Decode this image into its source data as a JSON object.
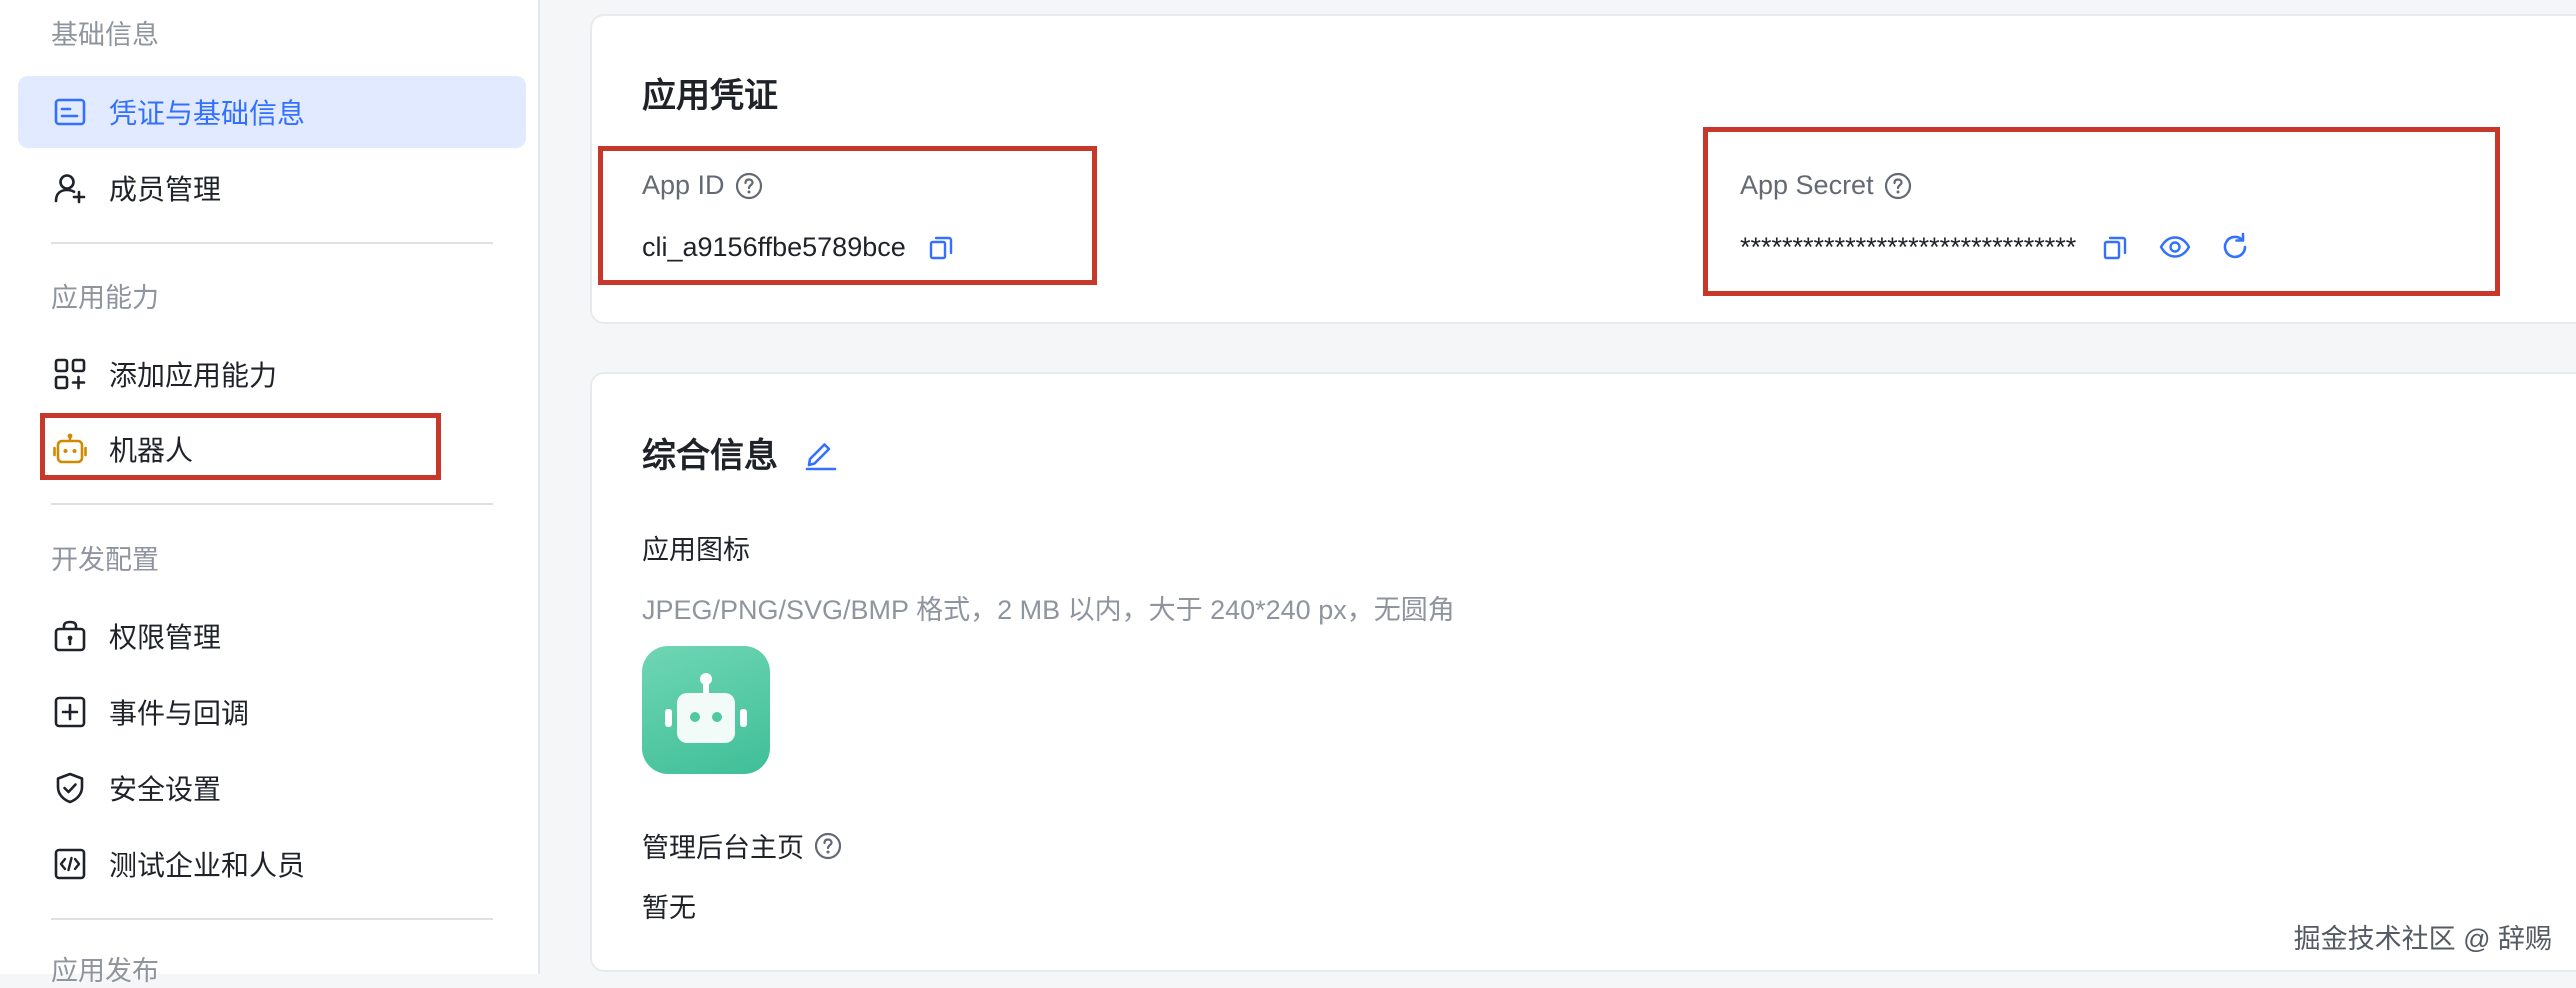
{
  "sidebar": {
    "groups": {
      "basic": "基础信息",
      "capability": "应用能力",
      "dev": "开发配置",
      "publish": "应用发布"
    },
    "items": {
      "credentials": "凭证与基础信息",
      "members": "成员管理",
      "add_capability": "添加应用能力",
      "bot": "机器人",
      "permissions": "权限管理",
      "events": "事件与回调",
      "security": "安全设置",
      "test_users": "测试企业和人员"
    }
  },
  "credentials": {
    "title": "应用凭证",
    "app_id_label": "App ID",
    "app_id_value": "cli_a9156ffbe5789bce",
    "app_secret_label": "App Secret",
    "app_secret_value": "********************************"
  },
  "info": {
    "title": "综合信息",
    "icon_label": "应用图标",
    "icon_hint": "JPEG/PNG/SVG/BMP 格式，2 MB 以内，大于 240*240 px，无圆角",
    "homepage_label": "管理后台主页",
    "homepage_value": "暂无"
  },
  "watermark": "掘金技术社区 @ 辞赐",
  "colors": {
    "accent": "#3370ff",
    "highlight_box": "#c7372a",
    "active_bg": "#e1eaff",
    "robot_icon": "#d08a00",
    "app_icon_green": "#4fc9a2"
  },
  "icons": {
    "credentials": "id-card-icon",
    "members": "add-person-icon",
    "add_capability": "apps-add-icon",
    "bot": "robot-icon",
    "permissions": "lock-bag-icon",
    "events": "plus-square-icon",
    "security": "shield-icon",
    "test_users": "code-icon",
    "copy": "copy-icon",
    "view": "eye-icon",
    "reset": "refresh-icon",
    "help": "question-circle-icon",
    "edit": "edit-icon"
  }
}
